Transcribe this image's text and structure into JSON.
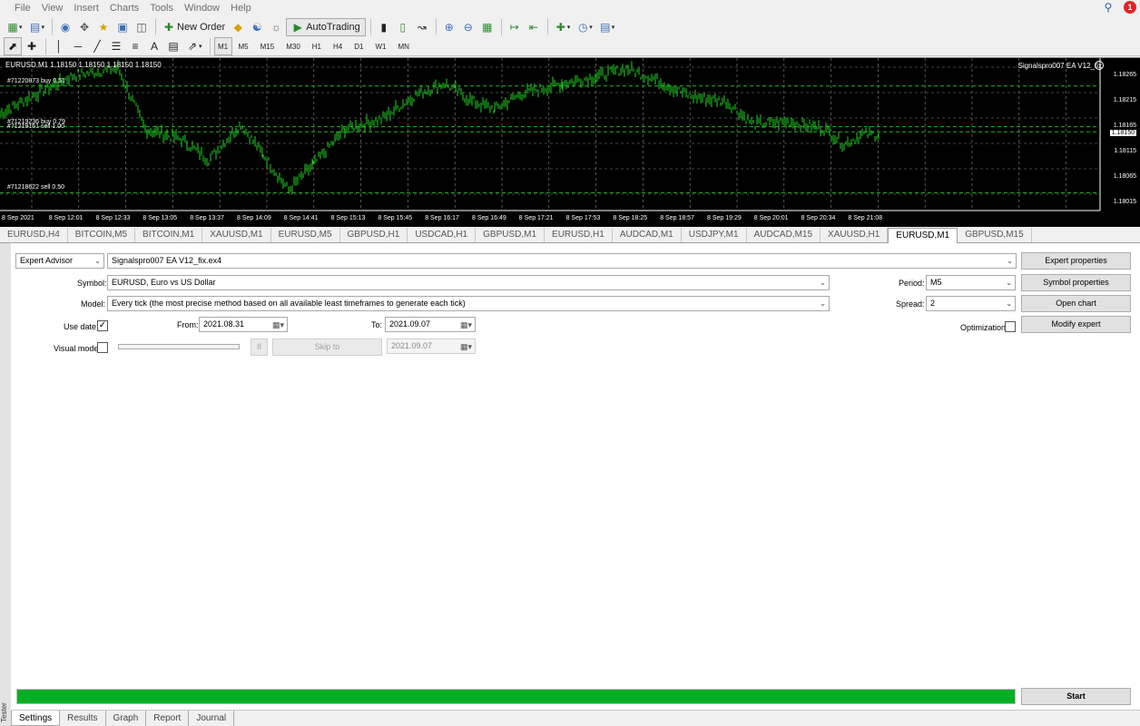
{
  "menu": [
    "File",
    "View",
    "Insert",
    "Charts",
    "Tools",
    "Window",
    "Help"
  ],
  "notification_count": "1",
  "toolbar": {
    "new_order": "New Order",
    "autotrading": "AutoTrading",
    "timeframes": [
      "M1",
      "M5",
      "M15",
      "M30",
      "H1",
      "H4",
      "D1",
      "W1",
      "MN"
    ]
  },
  "chart": {
    "title": "EURUSD,M1  1.18150 1.18150 1.18150 1.18150",
    "ea_name": "Signalspro007 EA V12_fix",
    "orders": [
      {
        "label": "#71220873 buy 0.51",
        "price": 1.18245
      },
      {
        "label": "#71219236 buy 0.79",
        "price": 1.18165
      },
      {
        "label": "#71219151 sell 1.00",
        "price": 1.18155
      },
      {
        "label": "#71218622 sell 0.50",
        "price": 1.18035
      }
    ],
    "price_labels": [
      "1.18265",
      "1.18215",
      "1.18165",
      "1.18150",
      "1.18115",
      "1.18065",
      "1.18015"
    ],
    "current_price": "1.18150",
    "time_labels": [
      "8 Sep 2021",
      "8 Sep 12:01",
      "8 Sep 12:33",
      "8 Sep 13:05",
      "8 Sep 13:37",
      "8 Sep 14:09",
      "8 Sep 14:41",
      "8 Sep 15:13",
      "8 Sep 15:45",
      "8 Sep 16:17",
      "8 Sep 16:49",
      "8 Sep 17:21",
      "8 Sep 17:53",
      "8 Sep 18:25",
      "8 Sep 18:57",
      "8 Sep 19:29",
      "8 Sep 20:01",
      "8 Sep 20:34",
      "8 Sep 21:08"
    ]
  },
  "chart_tabs": [
    "EURUSD,H4",
    "BITCOIN,M5",
    "BITCOIN,M1",
    "XAUUSD,M1",
    "EURUSD,M5",
    "GBPUSD,H1",
    "USDCAD,H1",
    "GBPUSD,M1",
    "EURUSD,H1",
    "AUDCAD,M1",
    "USDJPY,M1",
    "AUDCAD,M15",
    "XAUUSD,H1",
    "EURUSD,M1",
    "GBPUSD,M15"
  ],
  "active_chart_tab": "EURUSD,M1",
  "tester": {
    "type": "Expert Advisor",
    "expert": "Signalspro007 EA V12_fix.ex4",
    "symbol_label": "Symbol:",
    "symbol": "EURUSD, Euro vs US Dollar",
    "model_label": "Model:",
    "model": "Every tick (the most precise method based on all available least timeframes to generate each tick)",
    "use_date_label": "Use date",
    "from_label": "From:",
    "from": "2021.08.31",
    "to_label": "To:",
    "to": "2021.09.07",
    "visual_mode_label": "Visual mode",
    "pause": "II",
    "skip_to": "Skip to",
    "skip_date": "2021.09.07",
    "period_label": "Period:",
    "period": "M5",
    "spread_label": "Spread:",
    "spread": "2",
    "optimization_label": "Optimization",
    "expert_properties": "Expert properties",
    "symbol_properties": "Symbol properties",
    "open_chart": "Open chart",
    "modify_expert": "Modify expert",
    "start": "Start",
    "progress": 1.0,
    "side_label": "Tester"
  },
  "bottom_tabs": [
    "Settings",
    "Results",
    "Graph",
    "Report",
    "Journal"
  ],
  "active_bottom_tab": "Settings"
}
